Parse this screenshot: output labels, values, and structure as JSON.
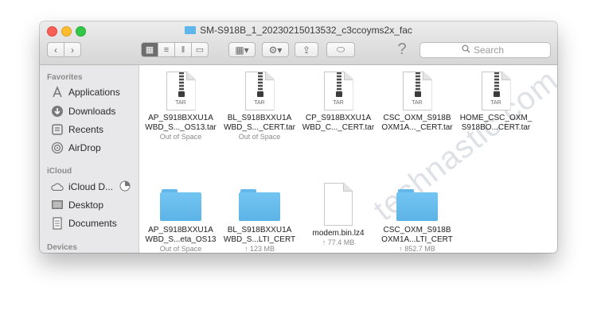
{
  "window": {
    "title": "SM-S918B_1_20230215013532_c3ccoyms2x_fac"
  },
  "toolbar": {
    "search_placeholder": "Search",
    "help_glyph": "?"
  },
  "sidebar": {
    "favorites_title": "Favorites",
    "favorites": [
      {
        "label": "Applications",
        "icon": "applications-icon"
      },
      {
        "label": "Downloads",
        "icon": "downloads-icon"
      },
      {
        "label": "Recents",
        "icon": "recents-icon"
      },
      {
        "label": "AirDrop",
        "icon": "airdrop-icon"
      }
    ],
    "icloud_title": "iCloud",
    "icloud": [
      {
        "label": "iCloud D...",
        "icon": "cloud-icon"
      },
      {
        "label": "Desktop",
        "icon": "desktop-icon"
      },
      {
        "label": "Documents",
        "icon": "documents-icon"
      }
    ],
    "devices_title": "Devices"
  },
  "files": [
    {
      "line1": "AP_S918BXXU1A",
      "line2": "WBD_S..._OS13.tar",
      "meta": "Out of Space",
      "kind": "tar"
    },
    {
      "line1": "BL_S918BXXU1A",
      "line2": "WBD_S..._CERT.tar",
      "meta": "Out of Space",
      "kind": "tar"
    },
    {
      "line1": "CP_S918BXXU1A",
      "line2": "WBD_C..._CERT.tar",
      "meta": "",
      "kind": "tar"
    },
    {
      "line1": "CSC_OXM_S918B",
      "line2": "OXM1A..._CERT.tar",
      "meta": "",
      "kind": "tar"
    },
    {
      "line1": "HOME_CSC_OXM_",
      "line2": "S918BO...CERT.tar",
      "meta": "",
      "kind": "tar"
    },
    {
      "line1": "AP_S918BXXU1A",
      "line2": "WBD_S...eta_OS13",
      "meta": "Out of Space",
      "kind": "folder"
    },
    {
      "line1": "BL_S918BXXU1A",
      "line2": "WBD_S...LTI_CERT",
      "meta": "↑ 123 MB",
      "kind": "folder"
    },
    {
      "line1": "modem.bin.lz4",
      "line2": "",
      "meta": "↑ 77.4 MB",
      "kind": "file"
    },
    {
      "line1": "CSC_OXM_S918B",
      "line2": "OXM1A...LTI_CERT",
      "meta": "↑ 852.7 MB",
      "kind": "folder"
    }
  ],
  "tar_label": "TAR",
  "watermark": "technastic.com",
  "colors": {
    "close": "#fc5f57",
    "minimize": "#fdbc2e",
    "zoom": "#33c748",
    "folder": "#5cb3e6",
    "sidebar": "#e8e8ea"
  }
}
